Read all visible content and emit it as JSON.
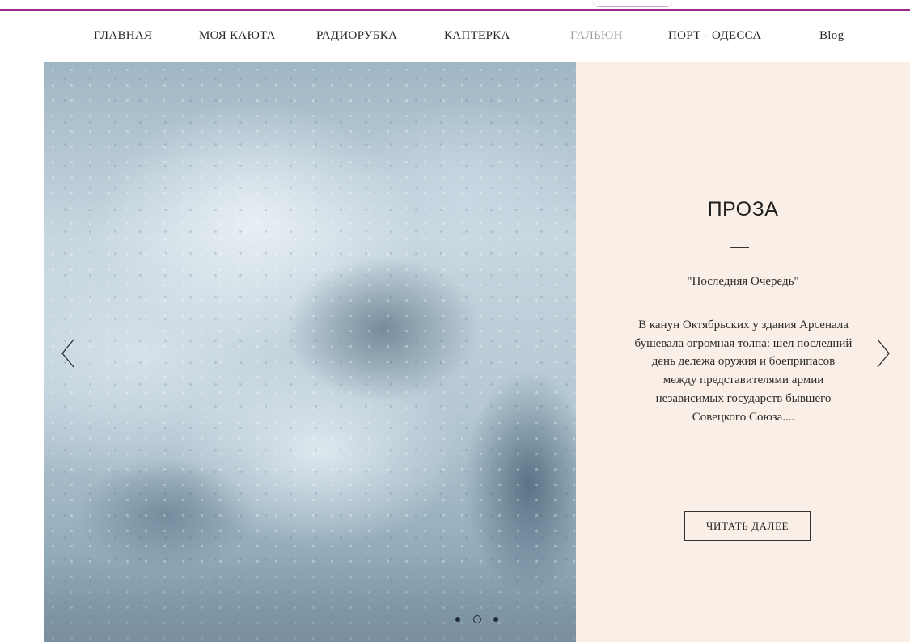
{
  "nav": {
    "items": [
      {
        "label": "ГЛАВНАЯ"
      },
      {
        "label": "МОЯ КАЮТА"
      },
      {
        "label": "РАДИОРУБКА"
      },
      {
        "label": "КАПТЕРКА"
      },
      {
        "label": "ГАЛЬЮН"
      },
      {
        "label": "ПОРТ - ОДЕССА"
      },
      {
        "label": "Blog"
      }
    ]
  },
  "slide": {
    "title": "ПРОЗА",
    "subtitle": "\"Последняя Очередь\"",
    "body": "В канун Октябрьских у здания Арсенала бушевала огромная толпа: шел последний день дележа оружия и боеприпасов между представителями армии независимых государств бывшего Совецкого Союза....",
    "button_label": "ЧИТАТЬ ДАЛЕЕ",
    "image_subject": "white sea foam / crashing water"
  },
  "controls": {
    "prev_icon": "chevron-left-icon",
    "next_icon": "chevron-right-icon",
    "slide_count": 3,
    "active_slide": 2
  },
  "colors": {
    "accent_rule": "#9b2a8f",
    "panel_background": "#f9efe6",
    "nav_current": "#a3a3a3"
  }
}
